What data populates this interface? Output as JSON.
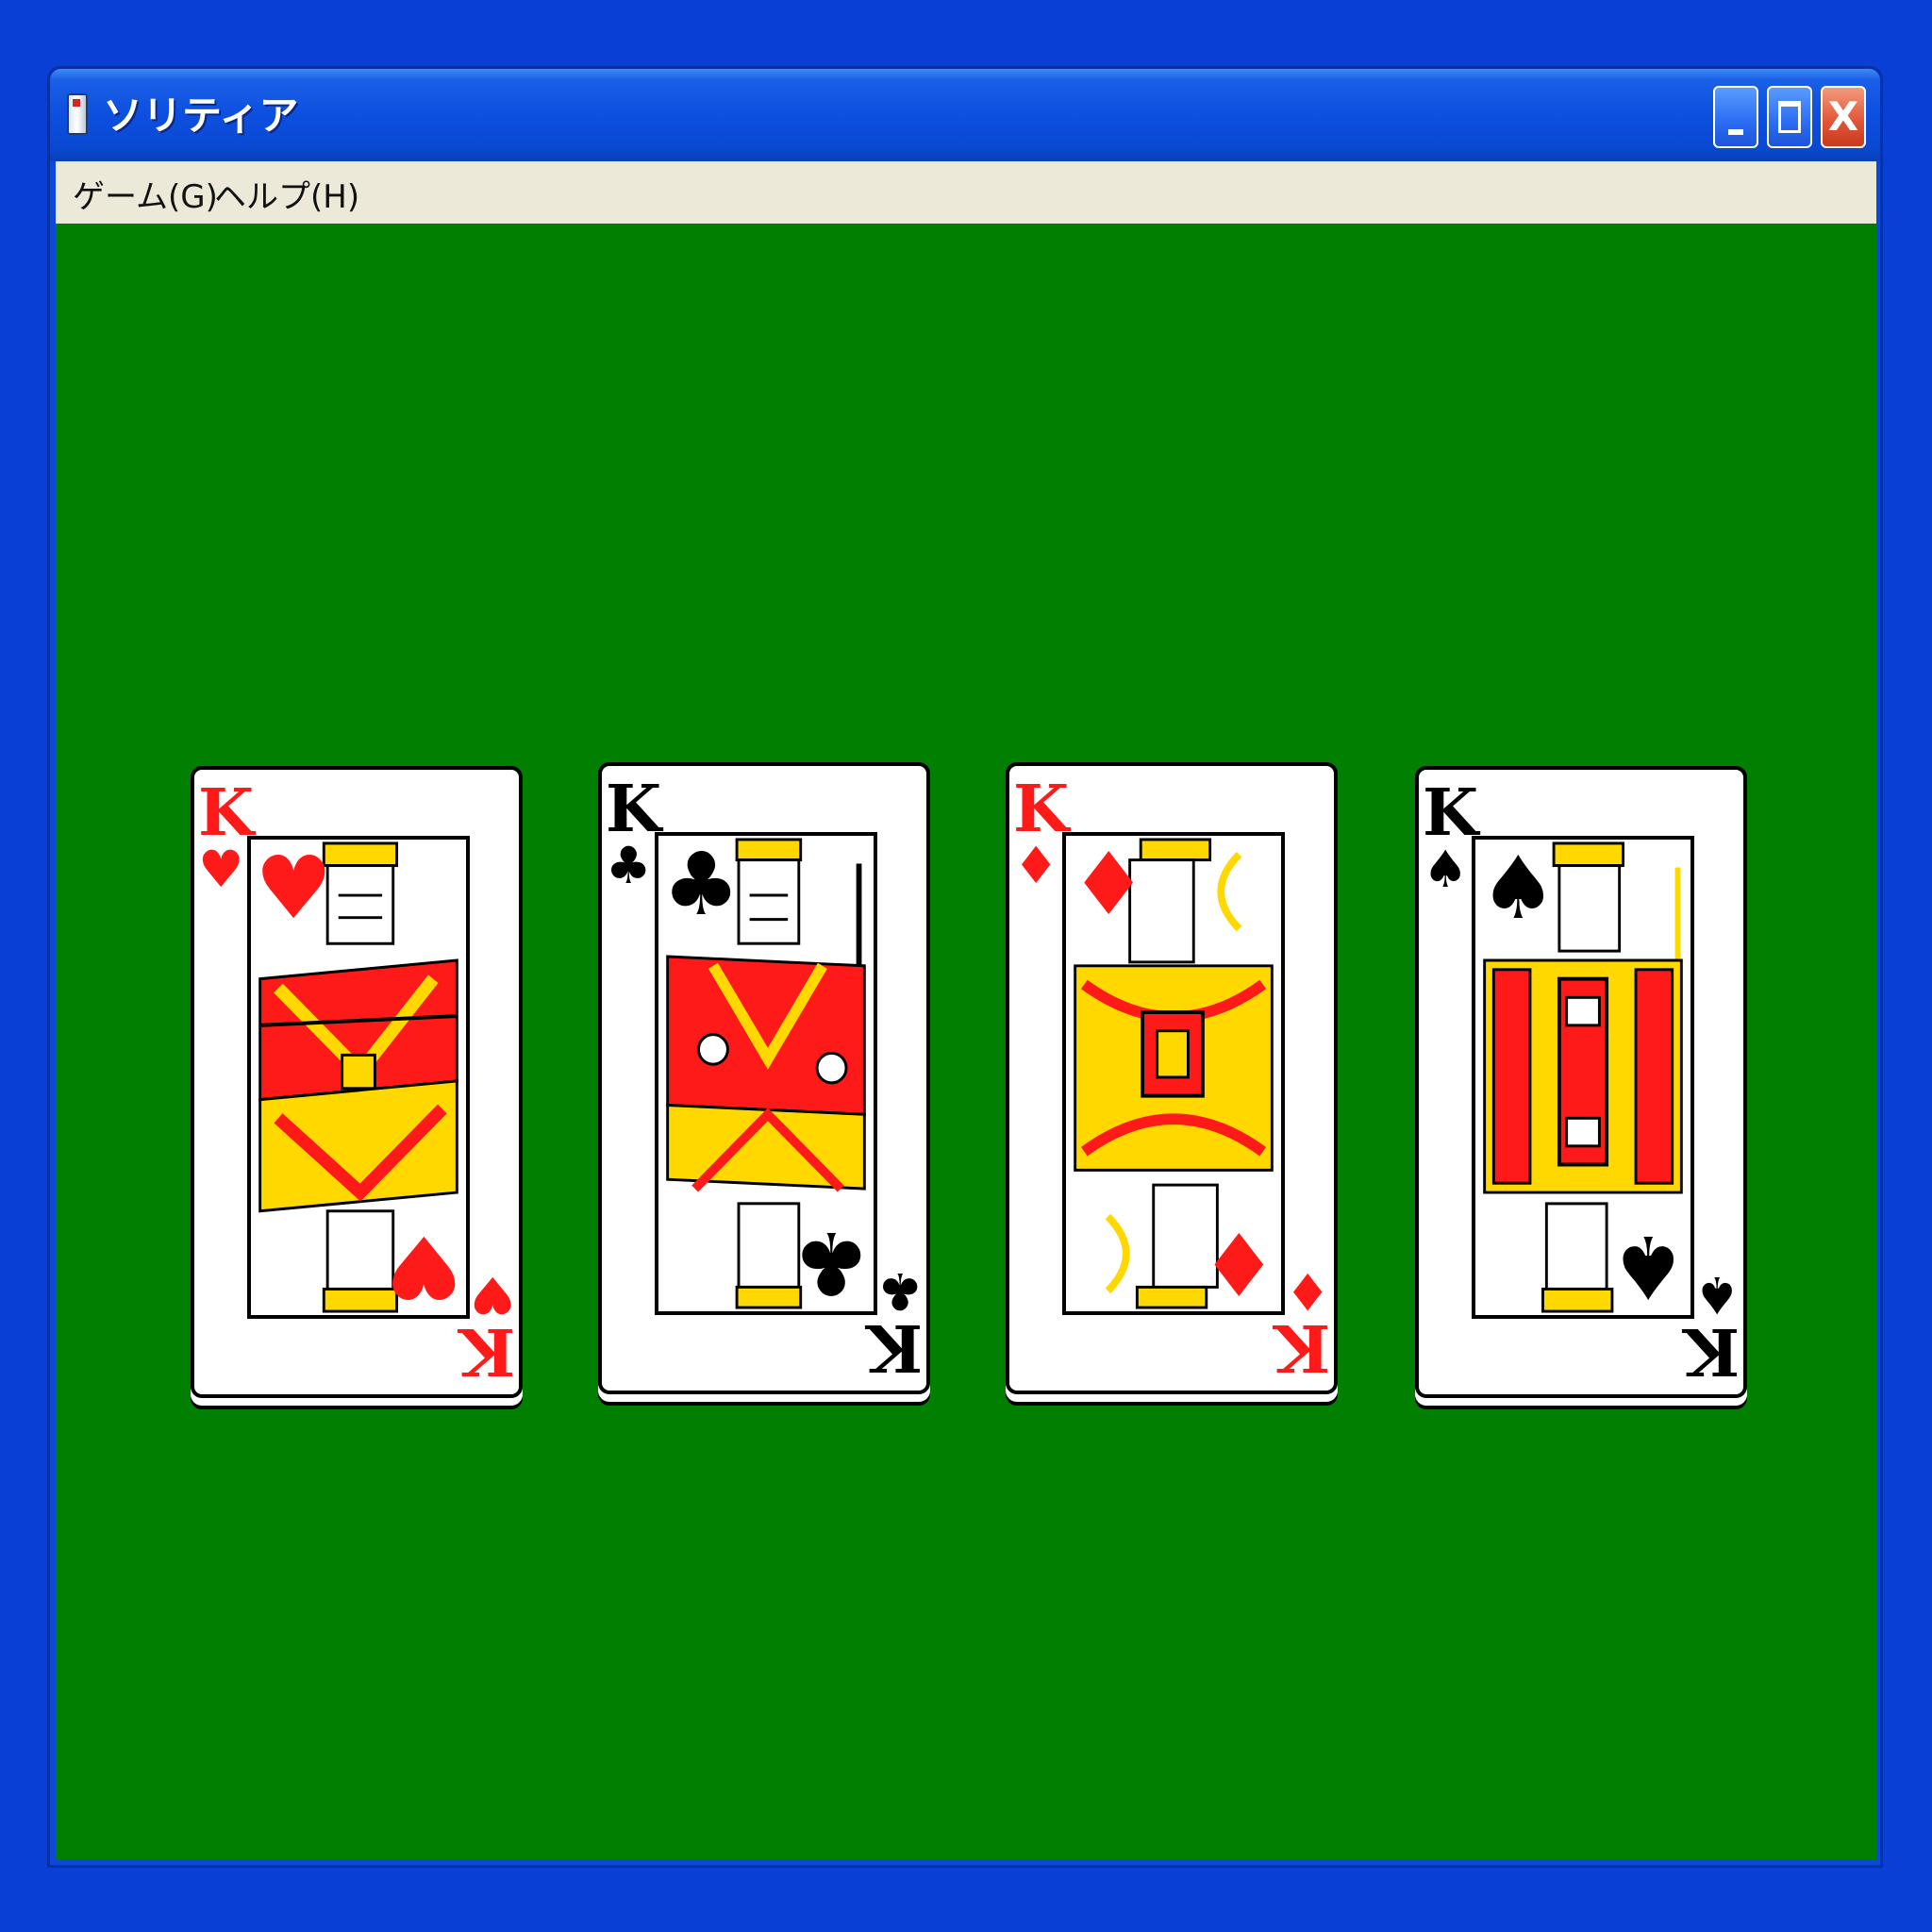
{
  "window": {
    "title": "ソリティア",
    "buttons": {
      "minimize": "minimize",
      "maximize": "maximize",
      "close": "X"
    }
  },
  "menu": {
    "items": [
      {
        "label": "ゲーム(G)"
      },
      {
        "label": "ヘルプ(H)"
      }
    ]
  },
  "colors": {
    "table": "#007f00",
    "desktop": "#0a3fd6",
    "red_suit": "#ff1a1a",
    "black_suit": "#000000"
  },
  "cards": [
    {
      "rank": "K",
      "suit": "♥",
      "suit_name": "hearts",
      "color": "red"
    },
    {
      "rank": "K",
      "suit": "♣",
      "suit_name": "clubs",
      "color": "black"
    },
    {
      "rank": "K",
      "suit": "♦",
      "suit_name": "diamonds",
      "color": "red"
    },
    {
      "rank": "K",
      "suit": "♠",
      "suit_name": "spades",
      "color": "black"
    }
  ]
}
